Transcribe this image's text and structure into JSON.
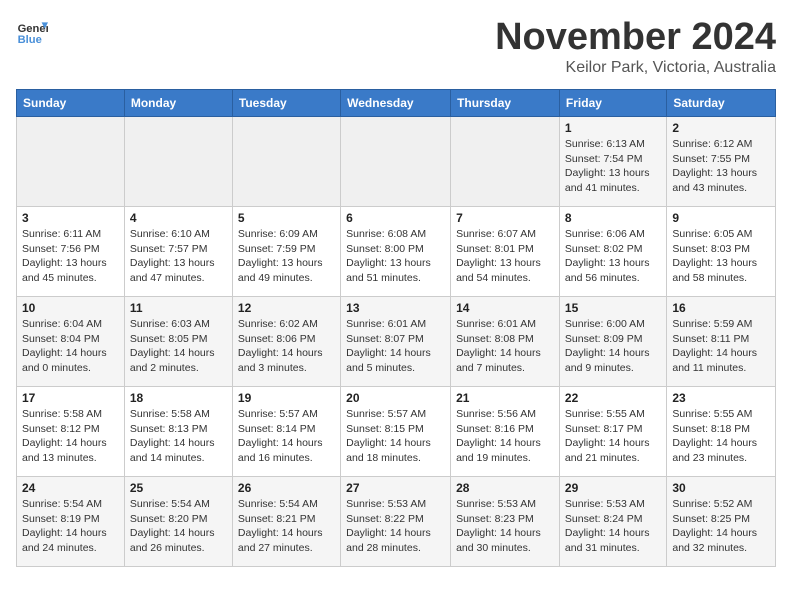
{
  "header": {
    "logo_line1": "General",
    "logo_line2": "Blue",
    "month": "November 2024",
    "location": "Keilor Park, Victoria, Australia"
  },
  "weekdays": [
    "Sunday",
    "Monday",
    "Tuesday",
    "Wednesday",
    "Thursday",
    "Friday",
    "Saturday"
  ],
  "weeks": [
    [
      {
        "day": "",
        "info": ""
      },
      {
        "day": "",
        "info": ""
      },
      {
        "day": "",
        "info": ""
      },
      {
        "day": "",
        "info": ""
      },
      {
        "day": "",
        "info": ""
      },
      {
        "day": "1",
        "info": "Sunrise: 6:13 AM\nSunset: 7:54 PM\nDaylight: 13 hours\nand 41 minutes."
      },
      {
        "day": "2",
        "info": "Sunrise: 6:12 AM\nSunset: 7:55 PM\nDaylight: 13 hours\nand 43 minutes."
      }
    ],
    [
      {
        "day": "3",
        "info": "Sunrise: 6:11 AM\nSunset: 7:56 PM\nDaylight: 13 hours\nand 45 minutes."
      },
      {
        "day": "4",
        "info": "Sunrise: 6:10 AM\nSunset: 7:57 PM\nDaylight: 13 hours\nand 47 minutes."
      },
      {
        "day": "5",
        "info": "Sunrise: 6:09 AM\nSunset: 7:59 PM\nDaylight: 13 hours\nand 49 minutes."
      },
      {
        "day": "6",
        "info": "Sunrise: 6:08 AM\nSunset: 8:00 PM\nDaylight: 13 hours\nand 51 minutes."
      },
      {
        "day": "7",
        "info": "Sunrise: 6:07 AM\nSunset: 8:01 PM\nDaylight: 13 hours\nand 54 minutes."
      },
      {
        "day": "8",
        "info": "Sunrise: 6:06 AM\nSunset: 8:02 PM\nDaylight: 13 hours\nand 56 minutes."
      },
      {
        "day": "9",
        "info": "Sunrise: 6:05 AM\nSunset: 8:03 PM\nDaylight: 13 hours\nand 58 minutes."
      }
    ],
    [
      {
        "day": "10",
        "info": "Sunrise: 6:04 AM\nSunset: 8:04 PM\nDaylight: 14 hours\nand 0 minutes."
      },
      {
        "day": "11",
        "info": "Sunrise: 6:03 AM\nSunset: 8:05 PM\nDaylight: 14 hours\nand 2 minutes."
      },
      {
        "day": "12",
        "info": "Sunrise: 6:02 AM\nSunset: 8:06 PM\nDaylight: 14 hours\nand 3 minutes."
      },
      {
        "day": "13",
        "info": "Sunrise: 6:01 AM\nSunset: 8:07 PM\nDaylight: 14 hours\nand 5 minutes."
      },
      {
        "day": "14",
        "info": "Sunrise: 6:01 AM\nSunset: 8:08 PM\nDaylight: 14 hours\nand 7 minutes."
      },
      {
        "day": "15",
        "info": "Sunrise: 6:00 AM\nSunset: 8:09 PM\nDaylight: 14 hours\nand 9 minutes."
      },
      {
        "day": "16",
        "info": "Sunrise: 5:59 AM\nSunset: 8:11 PM\nDaylight: 14 hours\nand 11 minutes."
      }
    ],
    [
      {
        "day": "17",
        "info": "Sunrise: 5:58 AM\nSunset: 8:12 PM\nDaylight: 14 hours\nand 13 minutes."
      },
      {
        "day": "18",
        "info": "Sunrise: 5:58 AM\nSunset: 8:13 PM\nDaylight: 14 hours\nand 14 minutes."
      },
      {
        "day": "19",
        "info": "Sunrise: 5:57 AM\nSunset: 8:14 PM\nDaylight: 14 hours\nand 16 minutes."
      },
      {
        "day": "20",
        "info": "Sunrise: 5:57 AM\nSunset: 8:15 PM\nDaylight: 14 hours\nand 18 minutes."
      },
      {
        "day": "21",
        "info": "Sunrise: 5:56 AM\nSunset: 8:16 PM\nDaylight: 14 hours\nand 19 minutes."
      },
      {
        "day": "22",
        "info": "Sunrise: 5:55 AM\nSunset: 8:17 PM\nDaylight: 14 hours\nand 21 minutes."
      },
      {
        "day": "23",
        "info": "Sunrise: 5:55 AM\nSunset: 8:18 PM\nDaylight: 14 hours\nand 23 minutes."
      }
    ],
    [
      {
        "day": "24",
        "info": "Sunrise: 5:54 AM\nSunset: 8:19 PM\nDaylight: 14 hours\nand 24 minutes."
      },
      {
        "day": "25",
        "info": "Sunrise: 5:54 AM\nSunset: 8:20 PM\nDaylight: 14 hours\nand 26 minutes."
      },
      {
        "day": "26",
        "info": "Sunrise: 5:54 AM\nSunset: 8:21 PM\nDaylight: 14 hours\nand 27 minutes."
      },
      {
        "day": "27",
        "info": "Sunrise: 5:53 AM\nSunset: 8:22 PM\nDaylight: 14 hours\nand 28 minutes."
      },
      {
        "day": "28",
        "info": "Sunrise: 5:53 AM\nSunset: 8:23 PM\nDaylight: 14 hours\nand 30 minutes."
      },
      {
        "day": "29",
        "info": "Sunrise: 5:53 AM\nSunset: 8:24 PM\nDaylight: 14 hours\nand 31 minutes."
      },
      {
        "day": "30",
        "info": "Sunrise: 5:52 AM\nSunset: 8:25 PM\nDaylight: 14 hours\nand 32 minutes."
      }
    ]
  ]
}
